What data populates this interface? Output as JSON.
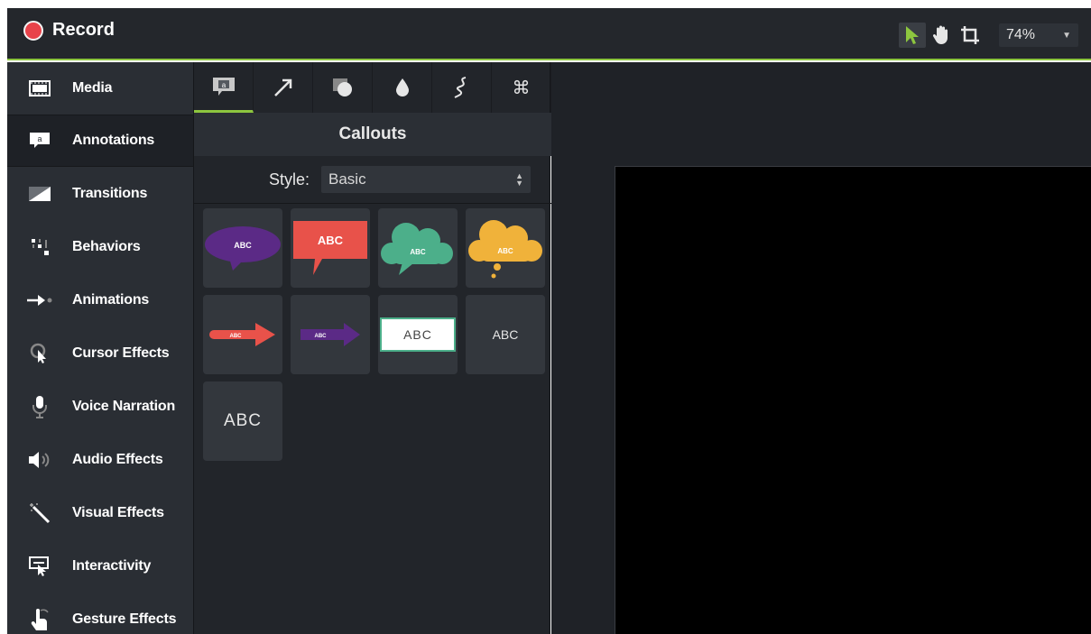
{
  "topbar": {
    "record_label": "Record",
    "zoom": "74%"
  },
  "sidebar": {
    "items": [
      {
        "label": "Media"
      },
      {
        "label": "Annotations"
      },
      {
        "label": "Transitions"
      },
      {
        "label": "Behaviors"
      },
      {
        "label": "Animations"
      },
      {
        "label": "Cursor Effects"
      },
      {
        "label": "Voice Narration"
      },
      {
        "label": "Audio Effects"
      },
      {
        "label": "Visual Effects"
      },
      {
        "label": "Interactivity"
      },
      {
        "label": "Gesture Effects"
      }
    ]
  },
  "panel": {
    "title": "Callouts",
    "style_label": "Style:",
    "style_value": "Basic",
    "tiles": [
      {
        "text": "ABC",
        "kind": "purple-bubble"
      },
      {
        "text": "ABC",
        "kind": "red-speech"
      },
      {
        "text": "ABC",
        "kind": "green-cloud"
      },
      {
        "text": "ABC",
        "kind": "yellow-thought"
      },
      {
        "text": "ABC",
        "kind": "red-arrow"
      },
      {
        "text": "ABC",
        "kind": "purple-arrow"
      },
      {
        "text": "ABC",
        "kind": "white-box"
      },
      {
        "text": "ABC",
        "kind": "plain-text-small"
      },
      {
        "text": "ABC",
        "kind": "plain-text-large"
      }
    ]
  },
  "colors": {
    "accent": "#8dc63f",
    "record": "#e8424a",
    "red": "#e8524a",
    "purple": "#5b2a86",
    "green": "#4caf8a",
    "yellow": "#f0b23a"
  }
}
